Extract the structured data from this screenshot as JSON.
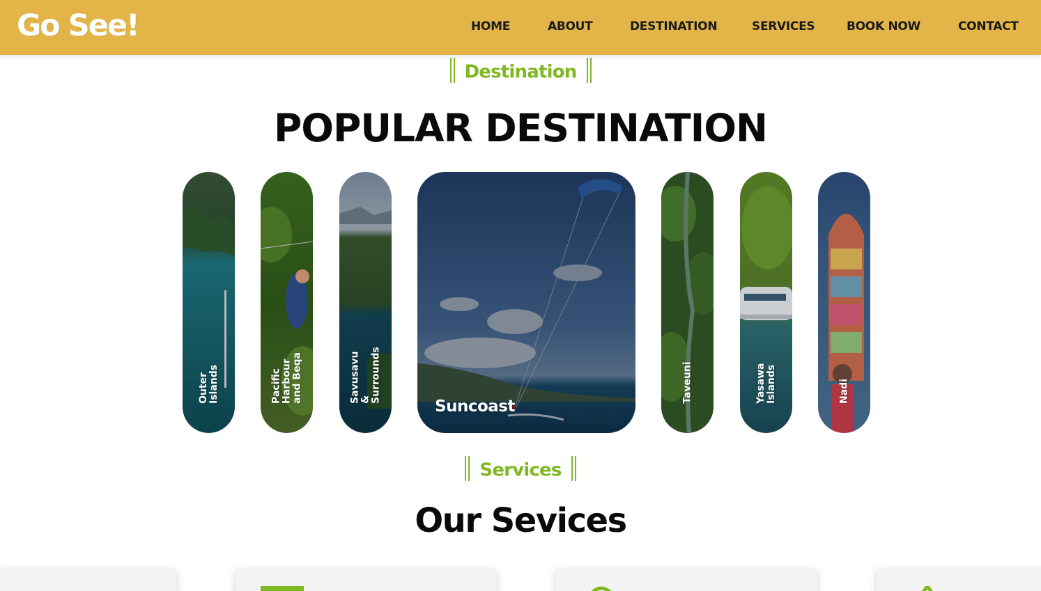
{
  "header": {
    "logo": "Go See!",
    "nav": [
      {
        "label": "HOME"
      },
      {
        "label": "ABOUT"
      },
      {
        "label": "DESTINATION"
      },
      {
        "label": "SERVICES"
      },
      {
        "label": "BOOK NOW"
      },
      {
        "label": "CONTACT"
      }
    ]
  },
  "destination_section": {
    "label": "Destination",
    "heading": "POPULAR DESTINATION",
    "cards": [
      {
        "name": "Outer Islands"
      },
      {
        "name": "Pacific Harbour and Beqa"
      },
      {
        "name": "Savusavu & Surrounds"
      },
      {
        "name": "Suncoast"
      },
      {
        "name": "Taveuni"
      },
      {
        "name": "Yasawa Islands"
      },
      {
        "name": "Nadi"
      }
    ]
  },
  "services_section": {
    "label": "Services",
    "heading": "Our Sevices"
  },
  "colors": {
    "header_bg": "#e3b548",
    "accent_green": "#7fb821",
    "heading_text": "#0a0a0a"
  }
}
